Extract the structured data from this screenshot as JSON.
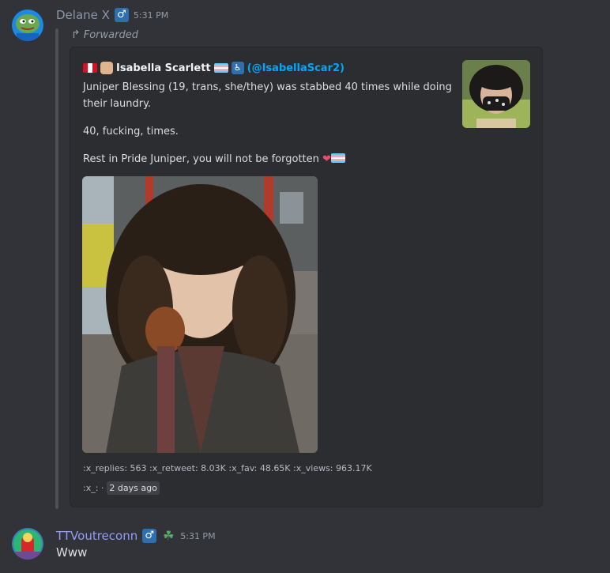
{
  "message1": {
    "username": "Delane X",
    "badge": "♂",
    "timestamp": "5:31 PM",
    "forwarded_label": "Forwarded",
    "embed": {
      "author_name": "Isabella Scarlett",
      "author_handle": "(@IsabellaScar2)",
      "paragraph1": "Juniper Blessing (19, trans, she/they) was stabbed 40 times while doing their laundry.",
      "paragraph2": "40, fucking, times.",
      "paragraph3": "Rest in Pride Juniper, you will not be forgotten",
      "stats": ":x_replies: 563  :x_retweet: 8.03K  :x_fav: 48.65K  :x_views: 963.17K",
      "footer_prefix": ":x_: ·",
      "footer_time": "2 days ago"
    }
  },
  "message2": {
    "username": "TTVoutreconn",
    "badge": "♂",
    "timestamp": "5:31 PM",
    "text": "Www"
  },
  "icons": {
    "forward": "forward-arrow-icon",
    "male": "male-sign-icon",
    "clover": "clover-icon",
    "heart": "heart-icon"
  },
  "colors": {
    "background": "#313338",
    "embed_background": "#2b2d31",
    "link": "#00a8fc",
    "username1": "#8a97a8",
    "username2": "#949cf7"
  }
}
